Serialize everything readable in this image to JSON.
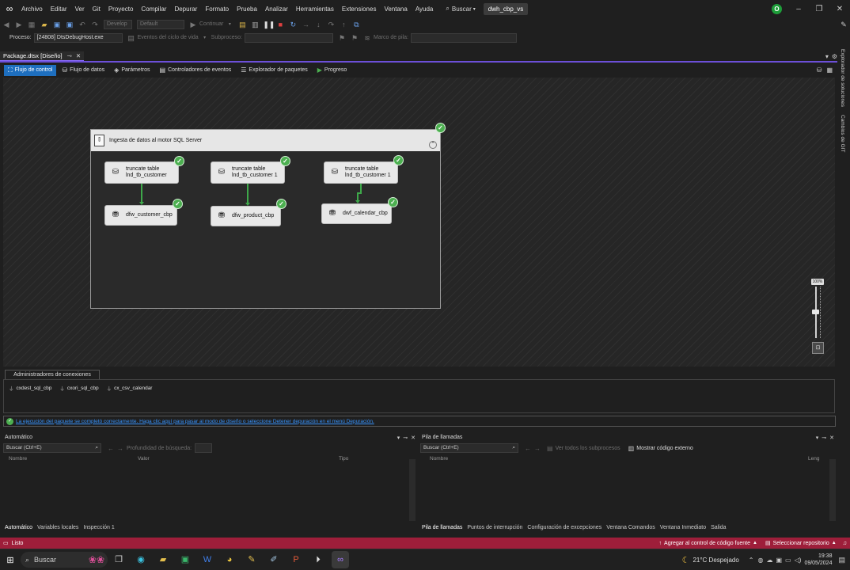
{
  "titlebar": {
    "menu": [
      "Archivo",
      "Editar",
      "Ver",
      "Git",
      "Proyecto",
      "Compilar",
      "Depurar",
      "Formato",
      "Prueba",
      "Analizar",
      "Herramientas",
      "Extensiones",
      "Ventana",
      "Ayuda"
    ],
    "search_label": "Buscar",
    "solution": "dwh_cbp_vs",
    "avatar_initial": "O"
  },
  "toolbar": {
    "config_combo": "Develop",
    "platform_combo": "Default",
    "continue_label": "Continuar",
    "process_label": "Proceso:",
    "process_value": "[24808] DtsDebugHost.exe",
    "lifecycle_label": "Eventos del ciclo de vida",
    "thread_label": "Subproceso:",
    "stackframe_label": "Marco de pila:"
  },
  "doc_tab": {
    "title": "Package.dtsx [Diseño]"
  },
  "ssis_tabs": [
    {
      "label": "Flujo de control",
      "active": true
    },
    {
      "label": "Flujo de datos",
      "active": false
    },
    {
      "label": "Parámetros",
      "active": false
    },
    {
      "label": "Controladores de eventos",
      "active": false
    },
    {
      "label": "Explorador de paquetes",
      "active": false
    },
    {
      "label": "Progreso",
      "active": false
    }
  ],
  "container": {
    "title": "Ingesta de datos al motor SQL Server",
    "tasks": [
      {
        "line1": "truncate table",
        "line2": "lnd_tb_customer"
      },
      {
        "line1": "truncate table",
        "line2": "lnd_tb_customer 1"
      },
      {
        "line1": "truncate table",
        "line2": "lnd_tb_customer 1"
      }
    ],
    "dataflows": [
      {
        "label": "dfw_customer_cbp"
      },
      {
        "label": "dfw_product_cbp"
      },
      {
        "label": "dwf_calendar_cbp"
      }
    ]
  },
  "zoom": {
    "label": "100%"
  },
  "connection_managers": {
    "tab_label": "Administradores de conexiones",
    "items": [
      "cxdest_sql_cbp",
      "cxori_sql_cbp",
      "cx_csv_calendar"
    ]
  },
  "infobar": {
    "message": "La ejecución del paquete se completó correctamente. Haga clic aquí para pasar al modo de diseño o seleccione Detener depuración en el menú Depuración."
  },
  "autos_panel": {
    "title": "Automático",
    "search_placeholder": "Buscar (Ctrl+E)",
    "depth_label": "Profundidad de búsqueda:",
    "columns": [
      "Nombre",
      "Valor",
      "Tipo"
    ],
    "tabs": [
      "Automático",
      "Variables locales",
      "Inspección 1"
    ]
  },
  "callstack_panel": {
    "title": "Pila de llamadas",
    "search_placeholder": "Buscar (Ctrl+E)",
    "threads_label": "Ver todos los subprocesos",
    "external_label": "Mostrar código externo",
    "columns": [
      "Nombre",
      "Leng"
    ],
    "tabs": [
      "Pila de llamadas",
      "Puntos de interrupción",
      "Configuración de excepciones",
      "Ventana Comandos",
      "Ventana Inmediato",
      "Salida"
    ]
  },
  "right_strip": [
    "Explorador de soluciones",
    "Cambios de GIT"
  ],
  "statusbar": {
    "ready": "Listo",
    "source_control": "Agregar al control de código fuente",
    "repo": "Seleccionar repositorio"
  },
  "taskbar": {
    "search": "Buscar",
    "weather": "21°C  Despejado",
    "time": "19:38",
    "date": "09/05/2024"
  }
}
